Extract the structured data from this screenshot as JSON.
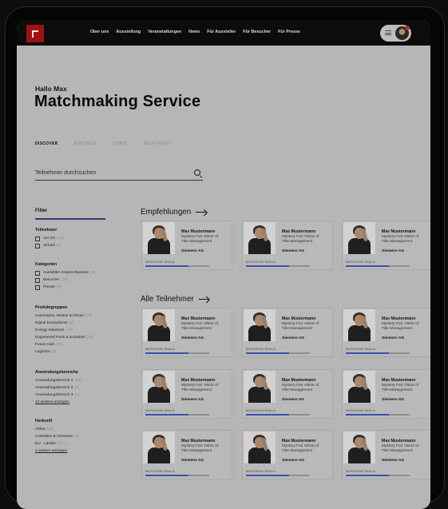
{
  "nav": {
    "items": [
      "Über uns",
      "Ausstellung",
      "Veranstaltungen",
      "News",
      "Für Aussteller",
      "Für Besucher",
      "Für Presse"
    ]
  },
  "page": {
    "greeting": "Hallo Max",
    "title": "Matchmaking Service"
  },
  "tabs": [
    {
      "label": "DISCOVER",
      "active": true
    },
    {
      "label": "KONTAKTE",
      "active": false
    },
    {
      "label": "CHATS",
      "active": false
    },
    {
      "label": "MEIN PROFIL",
      "active": false
    }
  ],
  "search": {
    "placeholder": "Teilnehmer durchsuchen"
  },
  "filter": {
    "title": "Filter",
    "groups": {
      "teilnehmer": {
        "title": "Teilnehmer",
        "items": [
          {
            "label": "Vor Ort",
            "count": "(18)"
          },
          {
            "label": "Virtuell",
            "count": "(1)"
          }
        ]
      },
      "kategorien": {
        "title": "Kategorien",
        "items": [
          {
            "label": "Aussteller Ansprechpartner",
            "count": "(4)"
          },
          {
            "label": "Besucher",
            "count": "(18)"
          },
          {
            "label": "Presse",
            "count": "(6)"
          }
        ]
      },
      "produktgruppen": {
        "title": "Produktgruppen",
        "items": [
          {
            "label": "Automation, Motion & Drives",
            "count": "(73)"
          },
          {
            "label": "Digital Ecosystems",
            "count": "(6)"
          },
          {
            "label": "Energy Solutions",
            "count": "(13)"
          },
          {
            "label": "Engineered Parts & Solutions",
            "count": "(29)"
          },
          {
            "label": "Future Hub",
            "count": "(18)"
          },
          {
            "label": "Logistics",
            "count": "(6)"
          }
        ]
      },
      "anwendungsbereiche": {
        "title": "Anwendungsbereiche",
        "items": [
          {
            "label": "Anwendungsbereich 1",
            "count": "(18)"
          },
          {
            "label": "Anwendungsbereich 2",
            "count": "(4)"
          },
          {
            "label": "Anwendungsbereich 3",
            "count": "(6)"
          }
        ],
        "more": "12 weitere anzeigen"
      },
      "herkunft": {
        "title": "Herkunft",
        "items": [
          {
            "label": "Afrika",
            "count": "(18)"
          },
          {
            "label": "Australien & Ozeanien",
            "count": "(4)"
          },
          {
            "label": "EU - Länder",
            "count": "(417)"
          }
        ],
        "more": "3 weitere anzeigen"
      }
    }
  },
  "sections": {
    "recommendations": "Empfehlungen",
    "all": "Alle Teilnehmer"
  },
  "card": {
    "name": "Max Mustermann",
    "role_line1": "Mystery Fair Visitor of",
    "role_line2": "Title Management",
    "company": "Siemens AG",
    "match_label": "MATCHING SKALA",
    "match_level": 0.68
  },
  "colors": {
    "accent": "#3c50a8",
    "brand": "#a31010"
  }
}
